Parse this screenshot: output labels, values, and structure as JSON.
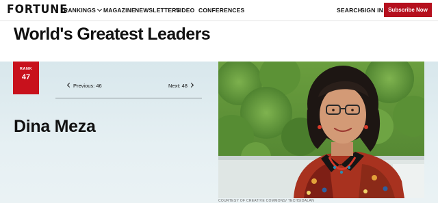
{
  "header": {
    "logo": "FORTUNE",
    "nav": {
      "rankings": "RANKINGS",
      "magazine": "MAGAZINE",
      "newsletters": "NEWSLETTERS",
      "video": "VIDEO",
      "conferences": "CONFERENCES"
    },
    "search": "SEARCH",
    "sign_in": "SIGN IN",
    "subscribe": "Subscribe Now"
  },
  "page": {
    "title": "World's Greatest Leaders"
  },
  "profile": {
    "rank_label": "RANK",
    "rank": "47",
    "previous": "Previous: 46",
    "next": "Next: 48",
    "name": "Dina Meza",
    "photo_credit": "COURTESY OF CREATIVE COMMONS/ TECHSIDALAN"
  },
  "colors": {
    "brand_red": "#c8111c",
    "subscribe_red": "#b5101e",
    "hero_background": "#e3eef1"
  }
}
